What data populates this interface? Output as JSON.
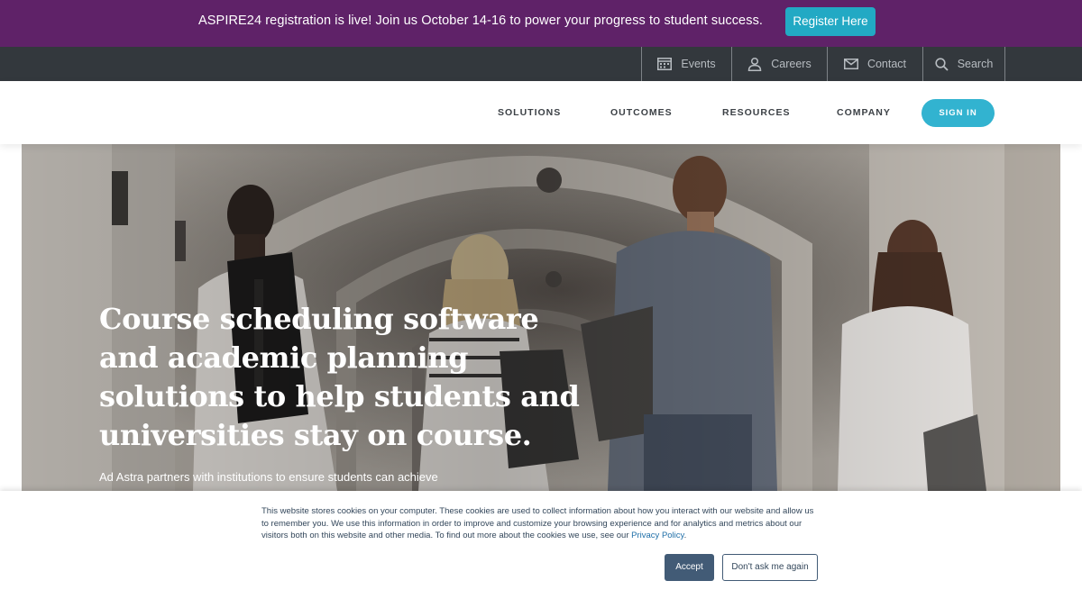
{
  "announcement": {
    "text": "ASPIRE24 registration is live! Join us October 14-16 to power your progress to student success.",
    "button_label": "Register Here"
  },
  "utility_nav": {
    "items": [
      {
        "label": "Events",
        "icon": "calendar-icon"
      },
      {
        "label": "Careers",
        "icon": "person-icon"
      },
      {
        "label": "Contact",
        "icon": "envelope-icon"
      },
      {
        "label": "Search",
        "icon": "search-icon"
      }
    ]
  },
  "main_nav": {
    "items": [
      "SOLUTIONS",
      "OUTCOMES",
      "RESOURCES",
      "COMPANY"
    ],
    "signin_label": "SIGN IN"
  },
  "hero": {
    "title": "Course scheduling software and academic planning solutions to help students and universities stay on course.",
    "subtitle": "Ad Astra partners with institutions to ensure students can achieve"
  },
  "cookie_banner": {
    "text": "This website stores cookies on your computer. These cookies are used to collect information about how you interact with our website and allow us to remember you. We use this information in order to improve and customize your browsing experience and for analytics and metrics about our visitors both on this website and other media. To find out more about the cookies we use, see our",
    "link_label": "Privacy Policy",
    "trailing": ".",
    "accept_label": "Accept",
    "decline_label": "Don't ask me again"
  },
  "colors": {
    "announcement_bg": "#5f2268",
    "utility_bg": "#33383d",
    "accent": "#32b3d0",
    "cookie_button": "#425b76"
  }
}
